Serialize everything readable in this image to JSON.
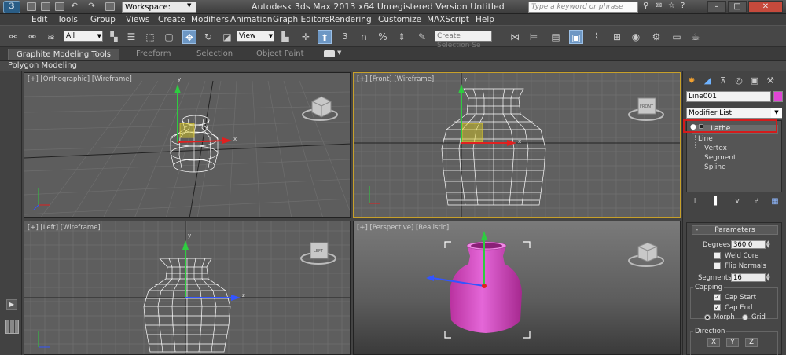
{
  "titlebar": {
    "app_logo": "3",
    "workspace": "Workspace: Default",
    "title": "Autodesk 3ds Max  2013 x64    Unregistered Version    Untitled",
    "search_placeholder": "Type a keyword or phrase"
  },
  "menu": [
    "Edit",
    "Tools",
    "Group",
    "Views",
    "Create",
    "Modifiers",
    "Animation",
    "Graph Editors",
    "Rendering",
    "Customize",
    "MAXScript",
    "Help"
  ],
  "toolbar": {
    "filter": "All",
    "ref_coord": "View",
    "selection_set": "Create Selection Se",
    "snap_number": "3",
    "percent_symbol": "%"
  },
  "ribbon": {
    "tabs": [
      "Graphite Modeling Tools",
      "Freeform",
      "Selection",
      "Object Paint"
    ],
    "sub_label": "Polygon Modeling"
  },
  "viewports": {
    "top": "[+] [Orthographic] [Wireframe]",
    "front": "[+] [Front] [Wireframe]",
    "left": "[+] [Left] [Wireframe]",
    "perspective": "[+] [Perspective] [Realistic]",
    "viewcube_front": "FRONT",
    "viewcube_left": "LEFT",
    "axis_x": "x",
    "axis_y": "y",
    "axis_z": "z"
  },
  "command_panel": {
    "object_name": "Line001",
    "object_color": "#e045d5",
    "modifier_list": "Modifier List",
    "stack": [
      "Lathe",
      "Line",
      "Vertex",
      "Segment",
      "Spline"
    ],
    "parameters_title": "Parameters",
    "degrees_label": "Degrees:",
    "degrees_value": "360.0",
    "weld_core": "Weld Core",
    "flip_normals": "Flip Normals",
    "segments_label": "Segments:",
    "segments_value": "16",
    "capping_label": "Capping",
    "cap_start": "Cap Start",
    "cap_end": "Cap End",
    "morph": "Morph",
    "grid": "Grid",
    "direction_label": "Direction",
    "dir_x": "X",
    "dir_y": "Y",
    "dir_z": "Z"
  },
  "colors": {
    "accent_highlight": "#d31b1b",
    "active_viewport_border": "#c7a02a",
    "vase_realistic": "#d44bcc",
    "wireframe": "#ffffff"
  }
}
